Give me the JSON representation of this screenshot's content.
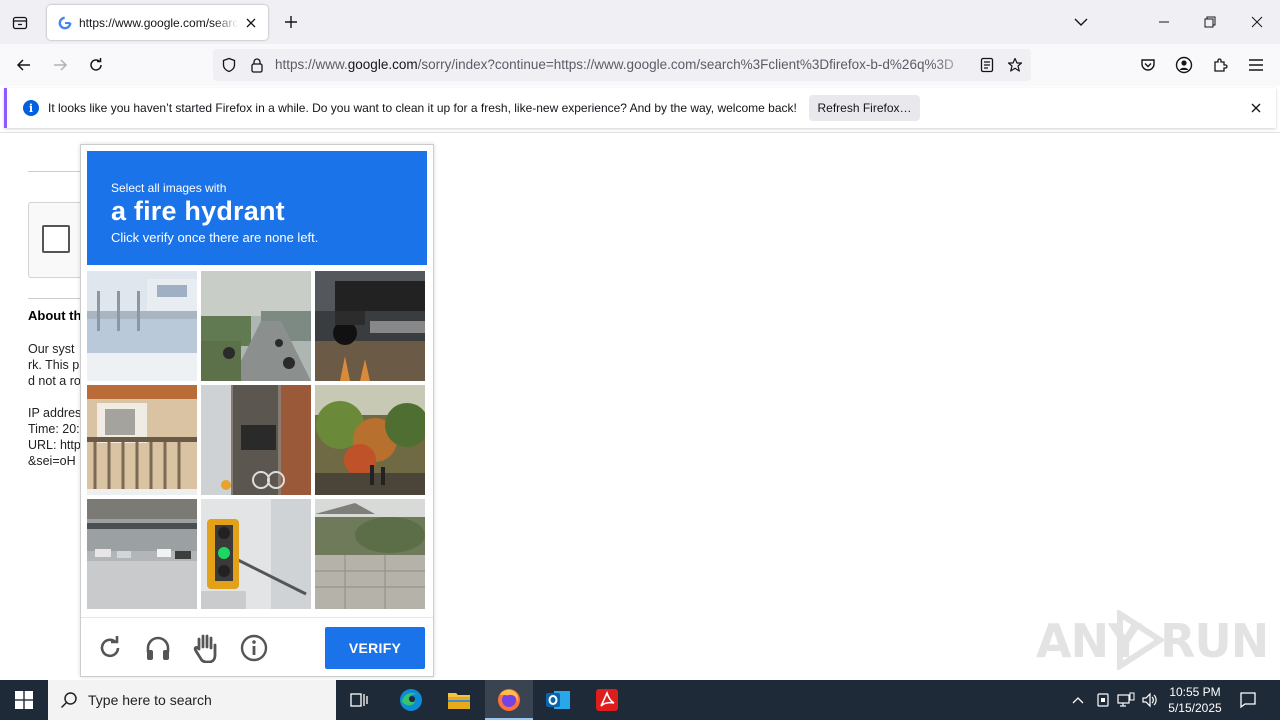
{
  "browser": {
    "tab": {
      "title": "https://www.google.com/search?client=firefox-b-d&q"
    },
    "url": {
      "prefix": "https://www.",
      "host": "google.com",
      "rest": "/sorry/index?continue=https://www.google.com/search%3Fclient%3Dfirefox-b-d%26q%3D"
    },
    "notification": {
      "text": "It looks like you haven’t started Firefox in a while. Do you want to clean it up for a fresh, like-new experience? And by the way, welcome back!",
      "button": "Refresh Firefox…"
    }
  },
  "page": {
    "about_title": "About th",
    "lines": [
      "Our syst",
      "rk. This p",
      "d not a ro",
      "",
      "IP addres",
      "Time: 20:",
      "URL: http",
      "&sei=oH"
    ]
  },
  "captcha": {
    "instruction": "Select all images with",
    "target": "a fire hydrant",
    "hint": "Click verify once there are none left.",
    "verify_label": "VERIFY",
    "tiles": [
      "bus stop shelter",
      "motorcycles on road",
      "parked motorcycle",
      "apartment balcony",
      "doorway with bicycle",
      "autumn trees",
      "parking lot",
      "traffic light",
      "stone wall"
    ]
  },
  "watermark": {
    "left": "ANY",
    "right": "RUN"
  },
  "taskbar": {
    "search_placeholder": "Type here to search",
    "time": "10:55 PM",
    "date": "5/15/2025"
  },
  "colors": {
    "captcha_blue": "#1a73e8",
    "taskbar": "#1f2a38",
    "notification_accent": "#9059ff"
  }
}
